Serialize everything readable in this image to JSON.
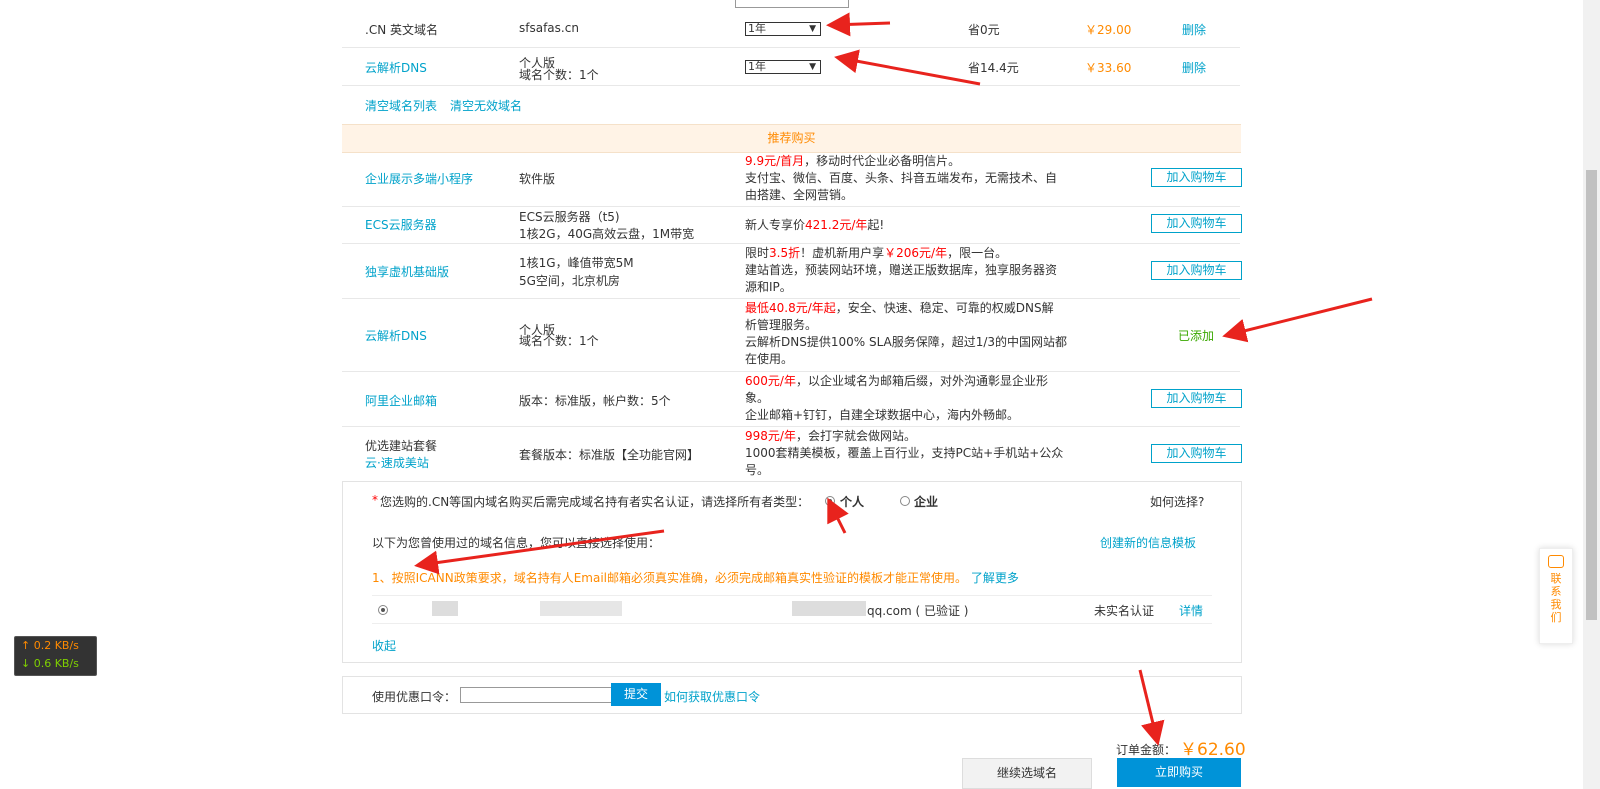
{
  "domains": [
    {
      "type": ".CN 英文域名",
      "detail": "sfsafas.cn",
      "period": "1年",
      "saving": "省0元",
      "price": "￥29.00",
      "delete": "删除"
    },
    {
      "type": "云解析DNS",
      "detail_line1": "个人版",
      "detail_line2": "域名个数：1个",
      "period": "1年",
      "saving": "省14.4元",
      "price": "￥33.60",
      "delete": "删除"
    }
  ],
  "list_actions": {
    "clear_list": "清空域名列表",
    "clear_invalid": "清空无效域名"
  },
  "recommend": {
    "header": "推荐购买",
    "add_label": "加入购物车",
    "added_label": "已添加",
    "items": [
      {
        "name": "企业展示多端小程序",
        "spec": "软件版",
        "desc_red": "9.9元/首月",
        "desc_rest": "，移动时代企业必备明信片。",
        "desc2": "支付宝、微信、百度、头条、抖音五端发布，无需技术、自",
        "desc3": "由搭建、全网营销。"
      },
      {
        "name": "ECS云服务器",
        "spec1": "ECS云服务器（t5)",
        "spec2": "1核2G，40G高效云盘，1M带宽",
        "desc_pre": "新人专享价",
        "desc_red": "421.2元/年",
        "desc_post": "起!"
      },
      {
        "name": "独享虚机基础版",
        "spec1": "1核1G，峰值带宽5M",
        "spec2": "5G空间，北京机房",
        "desc_pre": "限时",
        "desc_red": "3.5折",
        "desc_mid": "！虚机新用户享",
        "desc_red2": "￥206元/年",
        "desc_post": "，限一台。",
        "desc2": "建站首选，预装网站环境，赠送正版数据库，独享服务器资",
        "desc3": "源和IP。"
      },
      {
        "name": "云解析DNS",
        "spec1": "个人版",
        "spec2": "域名个数：1个",
        "desc_red": "最低40.8元/年起",
        "desc_rest": "，安全、快速、稳定、可靠的权威DNS解",
        "desc2": "析管理服务。",
        "desc3": "云解析DNS提供100% SLA服务保障，超过1/3的中国网站都",
        "desc4": "在使用。"
      },
      {
        "name": "阿里企业邮箱",
        "spec": "版本：标准版，帐户数：5个",
        "desc_red": "600元/年",
        "desc_rest": "，以企业域名为邮箱后缀，对外沟通彰显企业形",
        "desc2": "象。",
        "desc3": "企业邮箱+钉钉，自建全球数据中心，海内外畅邮。"
      },
      {
        "name_line1": "优选建站套餐",
        "name_line2": "云·速成美站",
        "spec": "套餐版本：标准版【全功能官网】",
        "desc_red": "998元/年",
        "desc_rest": "，会打字就会做网站。",
        "desc2": "1000套精美模板，覆盖上百行业，支持PC站+手机站+公众",
        "desc3": "号。"
      }
    ]
  },
  "owner": {
    "asterisk": "*",
    "prompt": "您选购的.CN等国内域名购买后需完成域名持有者实名认证，请选择所有者类型：",
    "opt_personal": "个人",
    "opt_company": "企业",
    "how_choose": "如何选择?",
    "used_info": "以下为您曾使用过的域名信息，您可以直接选择使用：",
    "create_template": "创建新的信息模板",
    "icann_notice": "1、按照ICANN政策要求，域名持有人Email邮箱必须真实准确，必须完成邮箱真实性验证的模板才能正常使用。",
    "learn_more": "了解更多",
    "record_email": "qq.com ( 已验证 )",
    "record_status": "未实名认证",
    "record_detail": "详情",
    "collapse": "收起"
  },
  "coupon": {
    "label": "使用优惠口令：",
    "submit": "提交",
    "help": "如何获取优惠口令"
  },
  "order": {
    "total_label": "订单金额：",
    "total_value": "￥62.60",
    "continue": "继续选域名",
    "buy_now": "立即购买"
  },
  "net_speed": {
    "up": "↑ 0.2 KB/s",
    "down": "↓ 0.6 KB/s"
  },
  "side_contact": "联系我们",
  "colors": {
    "accent": "#00a2ca",
    "orange": "#ff8a00",
    "red": "#ff0000",
    "green": "#3aa800",
    "buy_button": "#0093d8"
  }
}
